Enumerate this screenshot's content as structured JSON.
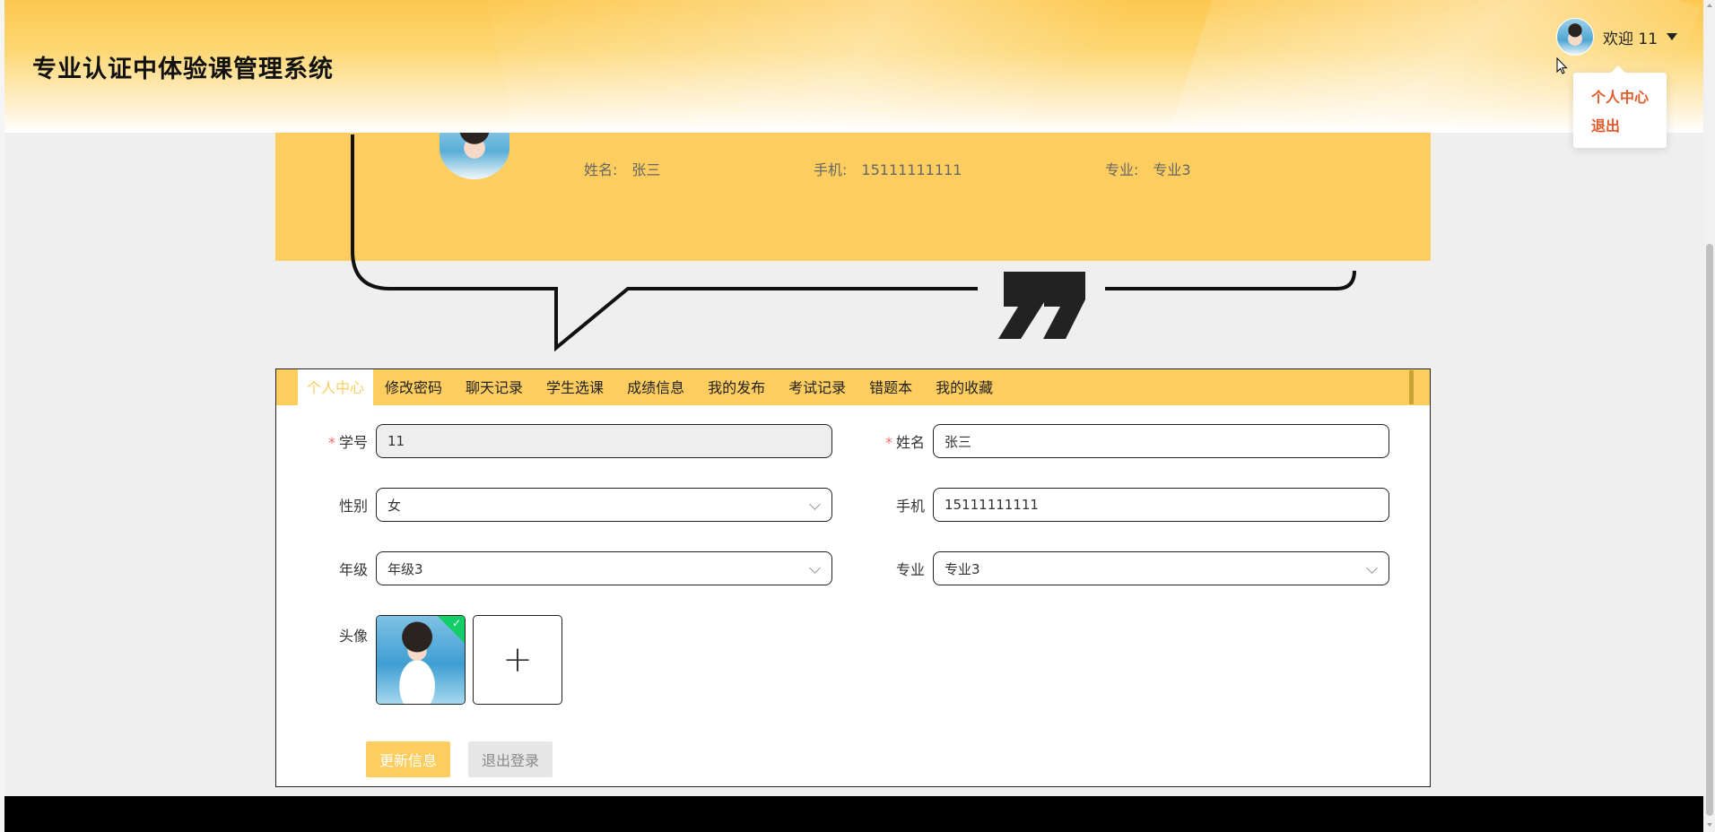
{
  "header": {
    "site_title": "专业认证中体验课管理系统",
    "welcome_text": "欢迎 11",
    "dropdown_items": [
      "个人中心",
      "退出"
    ]
  },
  "banner": {
    "name_label": "姓名:",
    "name_value": "张三",
    "phone_label": "手机:",
    "phone_value": "15111111111",
    "major_label": "专业:",
    "major_value": "专业3"
  },
  "tabs": [
    "个人中心",
    "修改密码",
    "聊天记录",
    "学生选课",
    "成绩信息",
    "我的发布",
    "考试记录",
    "错题本",
    "我的收藏"
  ],
  "active_tab": "个人中心",
  "form": {
    "student_id_label": "学号",
    "student_id_value": "11",
    "name_label": "姓名",
    "name_value": "张三",
    "gender_label": "性别",
    "gender_value": "女",
    "phone_label": "手机",
    "phone_value": "15111111111",
    "grade_label": "年级",
    "grade_value": "年级3",
    "major_label": "专业",
    "major_value": "专业3",
    "avatar_label": "头像",
    "required_mark": "*"
  },
  "buttons": {
    "update": "更新信息",
    "logout": "退出登录"
  },
  "colors": {
    "accent": "#fdcd5f",
    "dropdown_text": "#e35a2c",
    "required": "#f56c6c",
    "success": "#13ce66",
    "footer": "#000000"
  },
  "icons": {
    "caret": "caret-down-icon",
    "chevron": "chevron-down-icon",
    "plus": "plus-icon",
    "check": "check-icon",
    "quote": "quote-mark-icon",
    "cursor": "mouse-cursor-icon"
  }
}
